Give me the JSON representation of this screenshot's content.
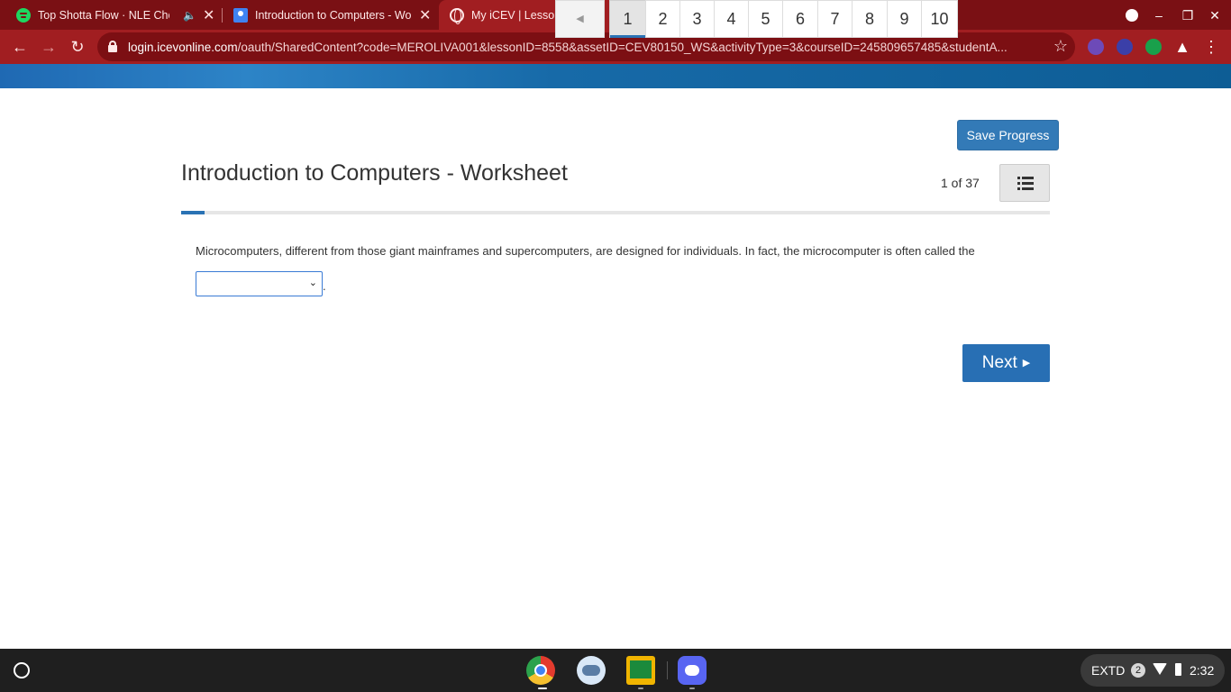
{
  "browser": {
    "tabs": [
      {
        "title": "Top Shotta Flow · NLE Chop",
        "favicon": "spotify-icon",
        "muted": true
      },
      {
        "title": "Introduction to Computers - Wor",
        "favicon": "classroom-icon"
      },
      {
        "title": "My iCEV | Lesson Detail",
        "favicon": "globe-icon",
        "active": true
      }
    ],
    "url_host": "login.icevonline.com",
    "url_path": "/oauth/SharedContent?code=MEROLIVA001&lessonID=8558&assetID=CEV80150_WS&activityType=3&courseID=245809657485&studentA..."
  },
  "page": {
    "save_label": "Save Progress",
    "title": "Introduction to Computers - Worksheet",
    "counter": "1 of 37",
    "progress_fraction": 0.027,
    "question_text": "Microcomputers, different from those giant mainframes and supercomputers, are designed for individuals. In fact, the microcomputer is often called the",
    "answer_value": "",
    "pages": [
      "1",
      "2",
      "3",
      "4",
      "5",
      "6",
      "7",
      "8",
      "9",
      "10"
    ],
    "active_page": "1",
    "next_label": "Next"
  },
  "shelf": {
    "apps": [
      "chrome-icon",
      "files-icon",
      "classroom-icon",
      "discord-icon"
    ],
    "ext_label": "EXTD",
    "notification_count": "2",
    "time": "2:32"
  },
  "colors": {
    "tabbar": "#7a1014",
    "toolbar": "#a11e21",
    "banner": "#1f69b3",
    "primary_button": "#337ab7",
    "next_button": "#286fb4"
  }
}
